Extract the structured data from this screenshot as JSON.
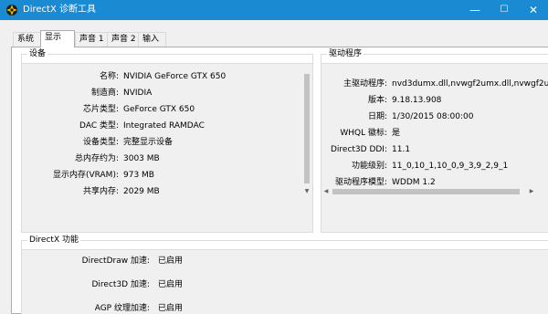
{
  "window": {
    "title": "DirectX 诊断工具",
    "accent_color": "#1a8ad3",
    "minimize_symbol": "—",
    "maximize_symbol": "☐",
    "close_symbol": "✕"
  },
  "tabs": [
    {
      "label": "系统",
      "active": false
    },
    {
      "label": "显示",
      "active": true
    },
    {
      "label": "声音 1",
      "active": false
    },
    {
      "label": "声音 2",
      "active": false
    },
    {
      "label": "输入",
      "active": false
    }
  ],
  "device": {
    "title": "设备",
    "rows": [
      {
        "label": "名称:",
        "value": "NVIDIA GeForce GTX 650"
      },
      {
        "label": "制造商:",
        "value": "NVIDIA"
      },
      {
        "label": "芯片类型:",
        "value": "GeForce GTX 650"
      },
      {
        "label": "DAC 类型:",
        "value": "Integrated RAMDAC"
      },
      {
        "label": "设备类型:",
        "value": "完整显示设备"
      },
      {
        "label": "总内存约为:",
        "value": "3003 MB"
      },
      {
        "label": "显示内存(VRAM):",
        "value": "973 MB"
      },
      {
        "label": "共享内存:",
        "value": "2029 MB"
      }
    ]
  },
  "driver": {
    "title": "驱动程序",
    "rows": [
      {
        "label": "主驱动程序:",
        "value": "nvd3dumx.dll,nvwgf2umx.dll,nvwgf2u"
      },
      {
        "label": "版本:",
        "value": "9.18.13.908"
      },
      {
        "label": "日期:",
        "value": "1/30/2015 08:00:00"
      },
      {
        "label": "WHQL 徽标:",
        "value": "是"
      },
      {
        "label": "Direct3D DDI:",
        "value": "11.1"
      },
      {
        "label": "功能级别:",
        "value": "11_0,10_1,10_0,9_3,9_2,9_1"
      },
      {
        "label": "驱动程序模型:",
        "value": "WDDM 1.2"
      }
    ]
  },
  "features": {
    "title": "DirectX 功能",
    "rows": [
      {
        "label": "DirectDraw 加速:",
        "value": "已启用"
      },
      {
        "label": "Direct3D 加速:",
        "value": "已启用"
      },
      {
        "label": "AGP 纹理加速:",
        "value": "已启用"
      }
    ]
  }
}
